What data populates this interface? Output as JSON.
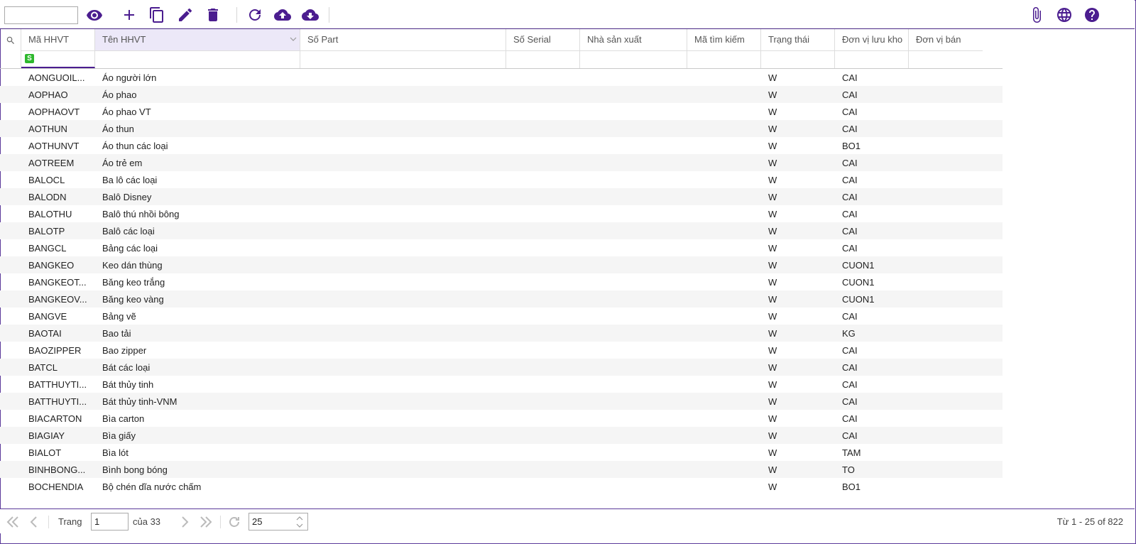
{
  "toolbar": {
    "search_value": "",
    "left_icons": [
      "eye-icon",
      "plus-icon",
      "copy-icon",
      "pencil-icon",
      "trash-icon",
      "refresh-icon",
      "cloud-upload-icon",
      "cloud-download-icon"
    ],
    "right_icons": [
      "paperclip-icon",
      "globe-icon",
      "help-icon"
    ],
    "accent_color": "#4b1d8f"
  },
  "grid": {
    "columns": [
      "Mã HHVT",
      "Tên HHVT",
      "Số Part",
      "Số Serial",
      "Nhà sản xuất",
      "Mã tìm kiếm",
      "Trạng thái",
      "Đơn vị lưu kho",
      "Đơn vị bán"
    ],
    "filter_badge": "S",
    "rows": [
      [
        "AONGUOIL...",
        "Áo người lớn",
        "",
        "",
        "",
        "",
        "W",
        "CAI",
        ""
      ],
      [
        "AOPHAO",
        "Áo phao",
        "",
        "",
        "",
        "",
        "W",
        "CAI",
        ""
      ],
      [
        "AOPHAOVT",
        "Áo phao VT",
        "",
        "",
        "",
        "",
        "W",
        "CAI",
        ""
      ],
      [
        "AOTHUN",
        "Áo thun",
        "",
        "",
        "",
        "",
        "W",
        "CAI",
        ""
      ],
      [
        "AOTHUNVT",
        "Áo thun các loại",
        "",
        "",
        "",
        "",
        "W",
        "BO1",
        ""
      ],
      [
        "AOTREEM",
        "Áo trẻ em",
        "",
        "",
        "",
        "",
        "W",
        "CAI",
        ""
      ],
      [
        "BALOCL",
        "Ba lô các loại",
        "",
        "",
        "",
        "",
        "W",
        "CAI",
        ""
      ],
      [
        "BALODN",
        "Balô Disney",
        "",
        "",
        "",
        "",
        "W",
        "CAI",
        ""
      ],
      [
        "BALOTHU",
        "Balô thú nhồi bông",
        "",
        "",
        "",
        "",
        "W",
        "CAI",
        ""
      ],
      [
        "BALOTP",
        "Balô các loại",
        "",
        "",
        "",
        "",
        "W",
        "CAI",
        ""
      ],
      [
        "BANGCL",
        "Bảng các loại",
        "",
        "",
        "",
        "",
        "W",
        "CAI",
        ""
      ],
      [
        "BANGKEO",
        "Keo dán thùng",
        "",
        "",
        "",
        "",
        "W",
        "CUON1",
        ""
      ],
      [
        "BANGKEOT...",
        "Băng keo trắng",
        "",
        "",
        "",
        "",
        "W",
        "CUON1",
        ""
      ],
      [
        "BANGKEOV...",
        "Băng keo vàng",
        "",
        "",
        "",
        "",
        "W",
        "CUON1",
        ""
      ],
      [
        "BANGVE",
        "Bảng vẽ",
        "",
        "",
        "",
        "",
        "W",
        "CAI",
        ""
      ],
      [
        "BAOTAI",
        "Bao tải",
        "",
        "",
        "",
        "",
        "W",
        "KG",
        ""
      ],
      [
        "BAOZIPPER",
        "Bao zipper",
        "",
        "",
        "",
        "",
        "W",
        "CAI",
        ""
      ],
      [
        "BATCL",
        "Bát các loại",
        "",
        "",
        "",
        "",
        "W",
        "CAI",
        ""
      ],
      [
        "BATTHUYTI...",
        "Bát thủy tinh",
        "",
        "",
        "",
        "",
        "W",
        "CAI",
        ""
      ],
      [
        "BATTHUYTI...",
        "Bát thủy tinh-VNM",
        "",
        "",
        "",
        "",
        "W",
        "CAI",
        ""
      ],
      [
        "BIACARTON",
        "Bìa carton",
        "",
        "",
        "",
        "",
        "W",
        "CAI",
        ""
      ],
      [
        "BIAGIAY",
        "Bìa giấy",
        "",
        "",
        "",
        "",
        "W",
        "CAI",
        ""
      ],
      [
        "BIALOT",
        "Bìa lót",
        "",
        "",
        "",
        "",
        "W",
        "TAM",
        ""
      ],
      [
        "BINHBONG...",
        "Bình bong bóng",
        "",
        "",
        "",
        "",
        "W",
        "TO",
        ""
      ],
      [
        "BOCHENDIA",
        "Bộ chén dĩa nước chấm",
        "",
        "",
        "",
        "",
        "W",
        "BO1",
        ""
      ]
    ]
  },
  "pager": {
    "page_label": "Trang",
    "page_value": "1",
    "of_label": "của 33",
    "page_size": "25",
    "summary": "Từ 1 - 25 of 822"
  }
}
